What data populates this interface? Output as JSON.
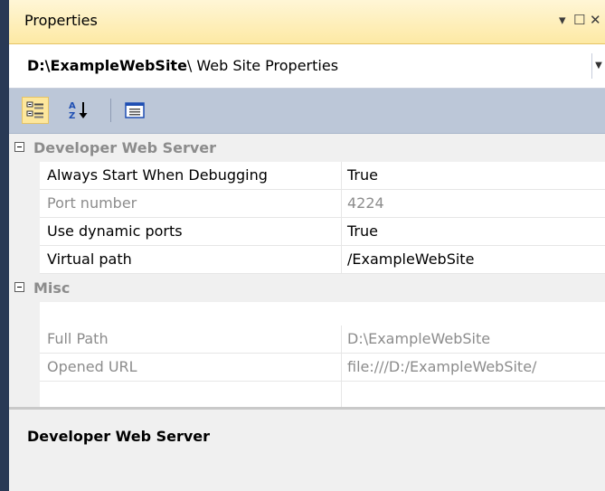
{
  "window": {
    "title": "Properties",
    "controls": {
      "dropdown": "▾",
      "maximize": "☐",
      "close": "✕"
    }
  },
  "object_selector": {
    "bold_text": "D:\\ExampleWebSite",
    "rest_text": "\\ Web Site Properties"
  },
  "toolbar": {
    "buttons": [
      {
        "name": "categorized",
        "active": true
      },
      {
        "name": "alphabetical",
        "active": false
      },
      {
        "name": "property-pages",
        "active": false
      }
    ]
  },
  "grid": {
    "categories": [
      {
        "label": "Developer Web Server",
        "rows": [
          {
            "name": "Always Start When Debugging",
            "value": "True",
            "readonly": false
          },
          {
            "name": "Port number",
            "value": "4224",
            "readonly": true
          },
          {
            "name": "Use dynamic ports",
            "value": "True",
            "readonly": false
          },
          {
            "name": "Virtual path",
            "value": "/ExampleWebSite",
            "readonly": false
          }
        ]
      },
      {
        "label": "Misc",
        "rows": [
          {
            "name": "Full Path",
            "value": "D:\\ExampleWebSite",
            "readonly": true
          },
          {
            "name": "Opened URL",
            "value": "file:///D:/ExampleWebSite/",
            "readonly": true
          }
        ]
      }
    ]
  },
  "description": {
    "title": "Developer Web Server"
  }
}
